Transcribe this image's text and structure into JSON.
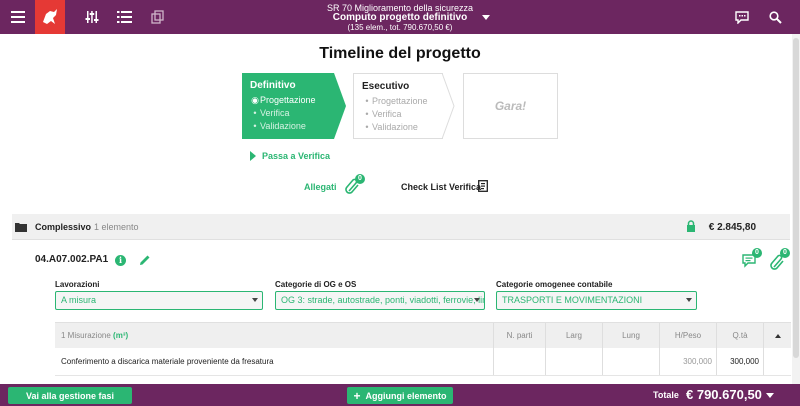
{
  "header": {
    "subtitle": "SR 70 Miglioramento della sicurezza",
    "title": "Computo progetto definitivo",
    "meta": "(135 elem., tot. 790.670,50 €)"
  },
  "page_title": "Timeline del progetto",
  "timeline": {
    "definitivo": {
      "title": "Definitivo",
      "items": [
        "Progettazione",
        "Verifica",
        "Validazione"
      ]
    },
    "esecutivo": {
      "title": "Esecutivo",
      "items": [
        "Progettazione",
        "Verifica",
        "Validazione"
      ]
    },
    "gara": {
      "title": "Gara!"
    }
  },
  "passa_label": "Passa a Verifica",
  "allegati": {
    "label": "Allegati",
    "count": "0"
  },
  "checklist_label": "Check List Verifica",
  "complessivo": {
    "label": "Complessivo",
    "count": "1 elemento",
    "total": "€ 2.845,80"
  },
  "element": {
    "code": "04.A07.002.PA1",
    "comments_count": "0",
    "attachments_count": "0"
  },
  "selects": {
    "lavorazioni": {
      "label": "Lavorazioni",
      "value": "A misura"
    },
    "categorie": {
      "label": "Categorie di OG e OS",
      "value": "OG 3: strade, autostrade, ponti, viadotti, ferrovie, linee"
    },
    "omogenee": {
      "label": "Categorie omogenee contabile",
      "value": "TRASPORTI E MOVIMENTAZIONI"
    }
  },
  "table": {
    "misurazione_label": "1 Misurazione",
    "misurazione_unit": "(m³)",
    "columns": [
      "N. parti",
      "Larg",
      "Lung",
      "H/Peso",
      "Q.tà"
    ],
    "rows": [
      {
        "desc": "Conferimento a discarica materiale proveniente da fresatura",
        "n_parti": "",
        "larg": "",
        "lung": "",
        "h_peso": "300,000",
        "qta": "300,000"
      }
    ]
  },
  "footer": {
    "fasi_button": "Vai alla gestione fasi",
    "add_button": "Aggiungi elemento",
    "total_label": "Totale",
    "total_value": "€ 790.670,50"
  },
  "colors": {
    "brand": "#6c2660",
    "accent": "#2bb673",
    "logo": "#e53935"
  },
  "icons": [
    "menu-icon",
    "sliders-icon",
    "list-icon",
    "stack-icon",
    "chat-icon",
    "search-icon",
    "paperclip-icon",
    "checklist-icon",
    "folder-icon",
    "lock-icon",
    "info-icon",
    "pencil-icon",
    "comment-icon"
  ]
}
